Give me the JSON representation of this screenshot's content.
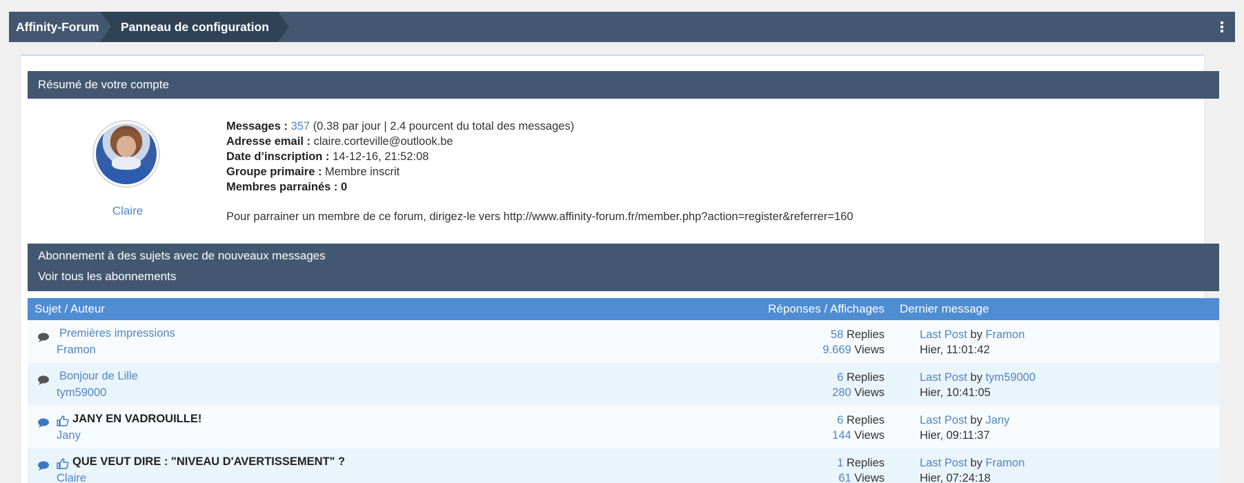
{
  "breadcrumb": {
    "home": "Affinity-Forum",
    "current": "Panneau de configuration"
  },
  "summary": {
    "header": "Résumé de votre compte",
    "username": "Claire",
    "messages_label": "Messages :",
    "messages_count": "357",
    "messages_detail": "(0.38 par jour | 2.4 pourcent du total des messages)",
    "email_label": "Adresse email :",
    "email_value": "claire.corteville@outlook.be",
    "signup_label": "Date d’inscription :",
    "signup_value": "14-12-16, 21:52:08",
    "group_label": "Groupe primaire :",
    "group_value": "Membre inscrit",
    "referred_label": "Membres parrainés : 0",
    "referral_text": "Pour parrainer un membre de ce forum, dirigez-le vers http://www.affinity-forum.fr/member.php?action=register&referrer=160"
  },
  "subscriptions": {
    "header": "Abonnement à des sujets avec de nouveaux messages",
    "view_all": "Voir tous les abonnements",
    "columns": {
      "subject": "Sujet / Auteur",
      "stats": "Réponses / Affichages",
      "last": "Dernier message"
    },
    "rows": [
      {
        "title": "Premières impressions",
        "author": "Framon",
        "replies": "58",
        "replies_label": "Replies",
        "views": "9.669",
        "views_label": "Views",
        "last_post": "Last Post",
        "by": "by",
        "last_author": "Framon",
        "last_time": "Hier, 11:01:42"
      },
      {
        "title": "Bonjour de Lille",
        "author": "tym59000",
        "replies": "6",
        "replies_label": "Replies",
        "views": "280",
        "views_label": "Views",
        "last_post": "Last Post",
        "by": "by",
        "last_author": "tym59000",
        "last_time": "Hier, 10:41:05"
      },
      {
        "title": "JANY EN VADROUILLE!",
        "author": "Jany",
        "replies": "6",
        "replies_label": "Replies",
        "views": "144",
        "views_label": "Views",
        "last_post": "Last Post",
        "by": "by",
        "last_author": "Jany",
        "last_time": "Hier, 09:11:37"
      },
      {
        "title": "QUE VEUT DIRE : \"NIVEAU D'AVERTISSEMENT\" ?",
        "author": "Claire",
        "replies": "1",
        "replies_label": "Replies",
        "views": "61",
        "views_label": "Views",
        "last_post": "Last Post",
        "by": "by",
        "last_author": "Framon",
        "last_time": "Hier, 07:24:18"
      }
    ]
  },
  "colors": {
    "header_bg": "#435870",
    "table_header_bg": "#4f8cd1",
    "link": "#4f86c6",
    "row_alt": "#eaf4fb"
  }
}
